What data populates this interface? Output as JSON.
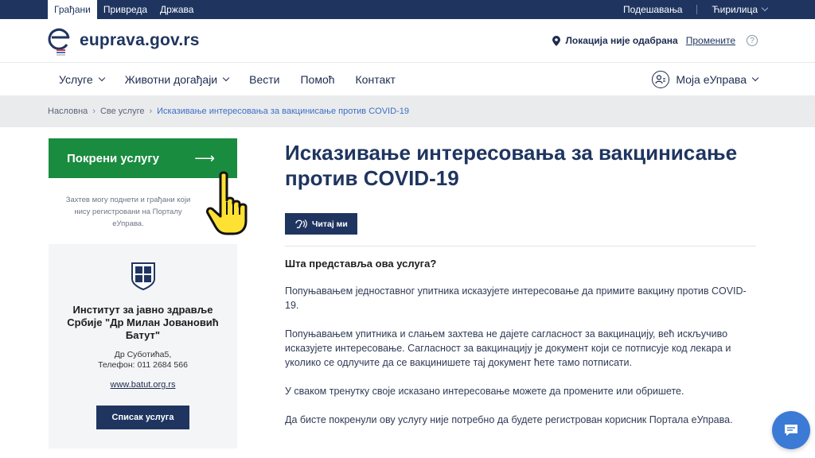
{
  "topbar": {
    "tabs": [
      "Грађани",
      "Привреда",
      "Држава"
    ],
    "settings": "Подешавања",
    "language": "Ћирилица"
  },
  "header": {
    "logo_text": "euprava.gov.rs",
    "location": "Локација није одабрана",
    "change": "Промените",
    "help": "?"
  },
  "nav": {
    "items": [
      "Услуге",
      "Животни догађаји",
      "Вести",
      "Помоћ",
      "Контакт"
    ],
    "account": "Моја еУправа"
  },
  "breadcrumb": [
    "Насловна",
    "Све услуге",
    "Исказивање интересовања за вакцинисање против COVID-19"
  ],
  "sidebar": {
    "start_label": "Покрени услугу",
    "hint": "Захтев могу поднети и грађани који нису регистровани на Порталу еУправа.",
    "institution_name": "Институт за јавно здравље Србије \"Др Милан Јовановић Батут\"",
    "address_line1": "Др Суботића5,",
    "address_line2": "Телефон: 011 2684 566",
    "website": "www.batut.org.rs",
    "services_button": "Списак услуга"
  },
  "main": {
    "title": "Исказивање интересовања за вакцинисање против COVID-19",
    "read_button": "Читај ми",
    "question": "Шта представља ова услуга?",
    "paragraphs": [
      "Попуњавањем једноставног упитника исказујете интересовање да примите вакцину против COVID-19.",
      "Попуњавањем упитника и слањем захтева не дајете сагласност за вакцинацију, већ искључиво исказујете интересовање. Сагласност за вакцинацију је документ који се потписује код лекара и уколико се одлучите да се вакцинишете тај документ ћете тамо потписати.",
      "У сваком тренутку своје исказано интересовање можете да промените или обришете.",
      "Да бисте покренули ову услугу није потребно да будете регистрован корисник Портала еУправа."
    ]
  },
  "colors": {
    "navy": "#1f3560",
    "green": "#1a8c3f",
    "link_blue": "#3b6fc4",
    "chat_blue": "#3b7bd6"
  }
}
